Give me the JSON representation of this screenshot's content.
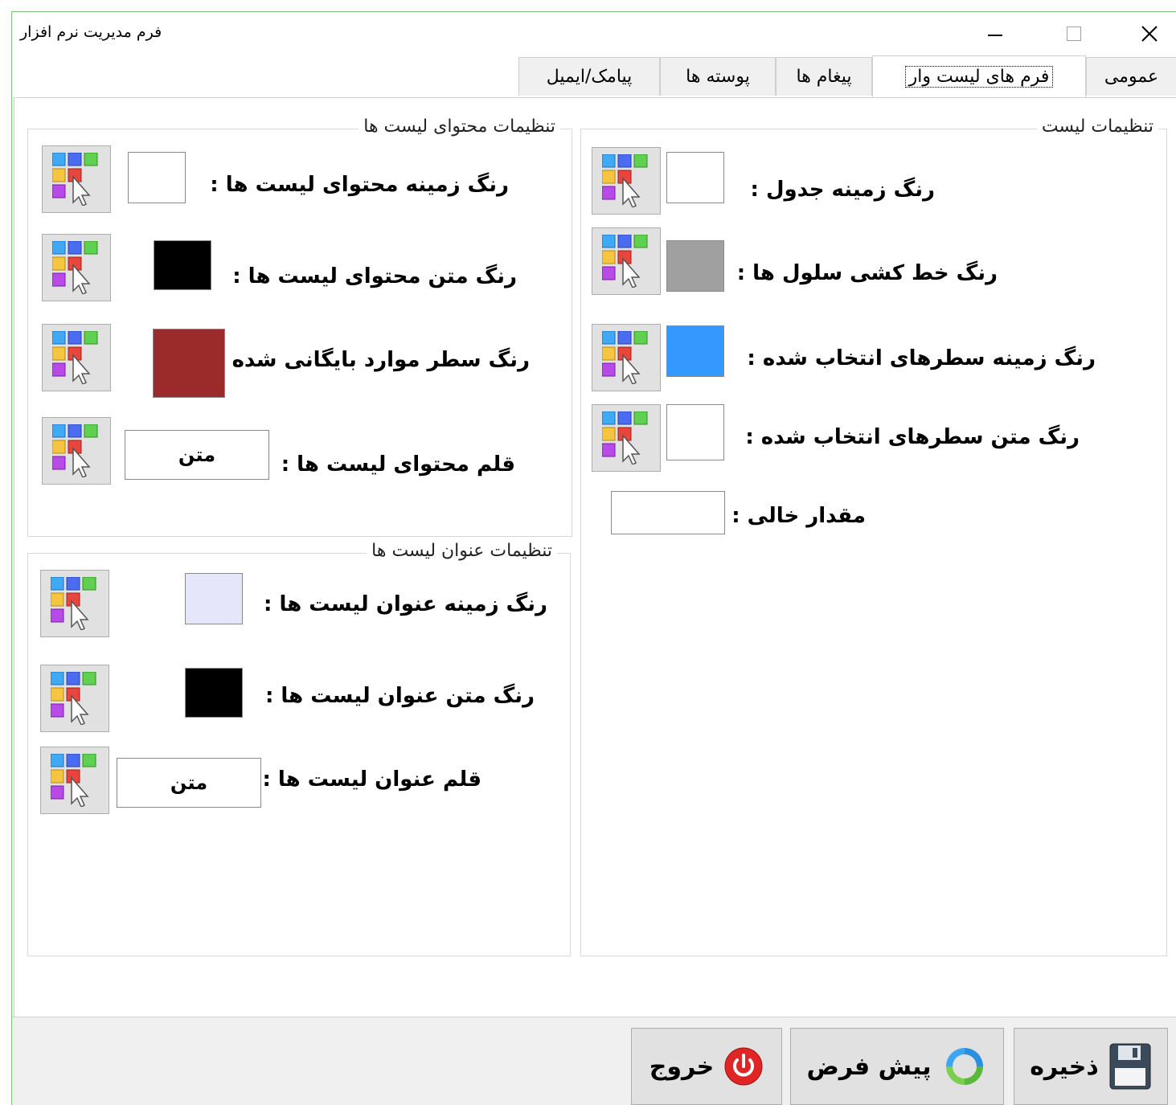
{
  "window": {
    "title": "فرم مدیریت نرم افزار"
  },
  "tabs": [
    {
      "label": "عمومی"
    },
    {
      "label": "فرم های لیست وار"
    },
    {
      "label": "پیغام ها"
    },
    {
      "label": "پوسته ها"
    },
    {
      "label": "پیامک/ایمیل"
    }
  ],
  "list_settings": {
    "title": "تنظیمات لیست",
    "table_bg_label": "رنگ زمینه جدول :",
    "table_bg_color": "#ffffff",
    "grid_line_label": "رنگ خط کشی سلول ها :",
    "grid_line_color": "#a0a0a0",
    "selected_bg_label": "رنگ زمینه سطرهای انتخاب شده :",
    "selected_bg_color": "#3399ff",
    "selected_text_label": "رنگ متن سطرهای انتخاب شده :",
    "selected_text_color": "#ffffff",
    "empty_value_label": "مقدار خالی :",
    "empty_value": ""
  },
  "content_settings": {
    "title": "تنظیمات محتوای لیست ها",
    "bg_label": "رنگ زمینه محتوای لیست ها :",
    "bg_color": "#ffffff",
    "text_label": "رنگ متن محتوای لیست ها :",
    "text_color": "#000000",
    "archived_label": "رنگ سطر موارد بایگانی شده",
    "archived_color": "#9b2b2b",
    "font_label": "قلم محتوای لیست ها :",
    "font_value": "متن"
  },
  "header_settings": {
    "title": "تنظیمات عنوان لیست ها",
    "bg_label": "رنگ زمینه عنوان لیست ها :",
    "bg_color": "#e6e6fa",
    "text_label": "رنگ متن عنوان لیست ها :",
    "text_color": "#000000",
    "font_label": "قلم عنوان لیست ها :",
    "font_value": "متن"
  },
  "actions": {
    "save": "ذخیره",
    "default": "پیش فرض",
    "exit": "خروج"
  }
}
